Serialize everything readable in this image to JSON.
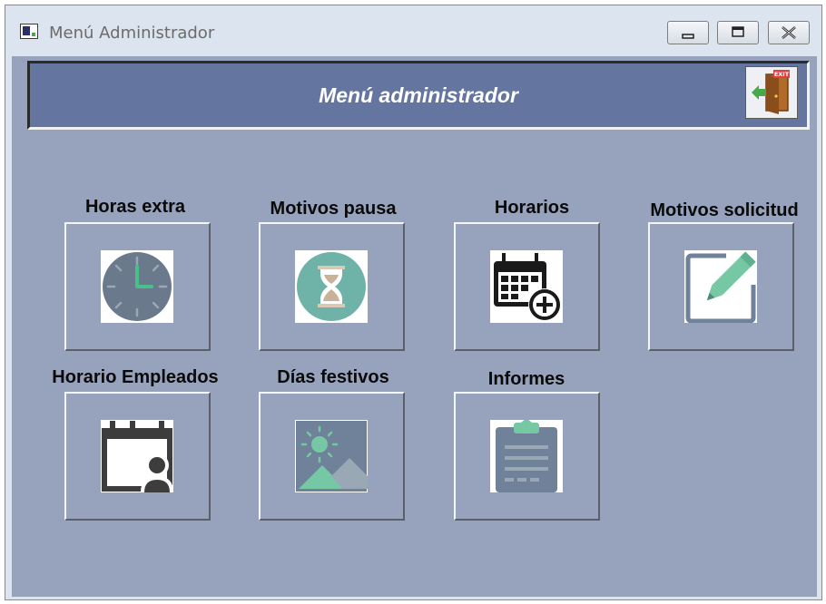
{
  "window": {
    "title": "Menú Administrador",
    "controls": [
      "minimize-icon",
      "maximize-icon",
      "close-icon"
    ]
  },
  "header": {
    "title": "Menú administrador",
    "exit_icon": "exit-door-icon",
    "exit_sign": "EXIT"
  },
  "menu": {
    "items": [
      {
        "label": "Horas extra",
        "icon": "clock-icon"
      },
      {
        "label": "Motivos pausa",
        "icon": "hourglass-icon"
      },
      {
        "label": "Horarios",
        "icon": "calendar-add-icon"
      },
      {
        "label": "Motivos solicitud",
        "icon": "edit-pencil-icon"
      },
      {
        "label": "Horario Empleados",
        "icon": "calendar-person-icon"
      },
      {
        "label": "Días festivos",
        "icon": "image-landscape-icon"
      },
      {
        "label": "Informes",
        "icon": "clipboard-report-icon"
      }
    ]
  },
  "colors": {
    "client_background": "#97a2bc",
    "header_background": "#6476a0",
    "clock": "#6a7a8c",
    "hourglass": "#6fb3a8",
    "pencil": "#76c7a4"
  }
}
